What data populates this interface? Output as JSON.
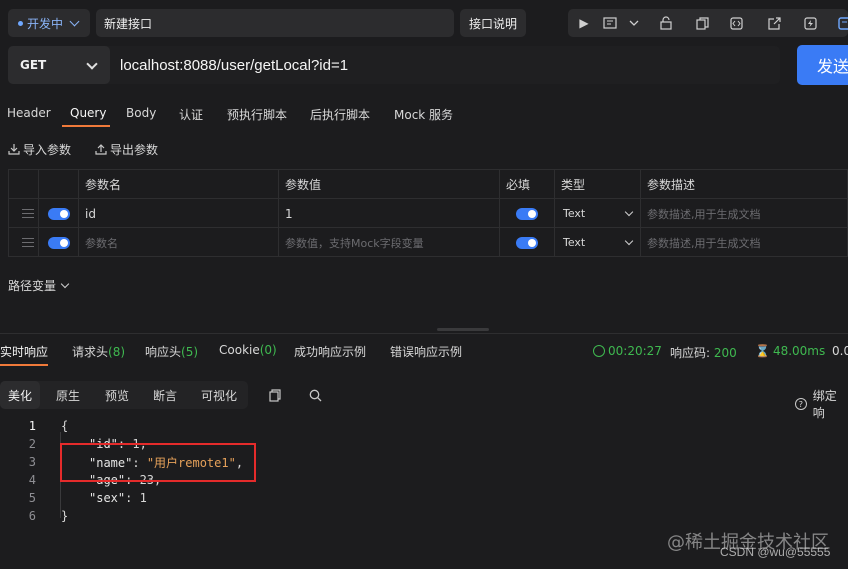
{
  "colors": {
    "accent": "#3a7bf5",
    "tab_underline": "#f07a3a",
    "success": "#3fb950",
    "env_dot": "#6fa8ff",
    "highlight": "#e52b2b"
  },
  "topbar": {
    "env_label": "开发中",
    "api_name": "新建接口",
    "doc_button": "接口说明",
    "tools": [
      "play-icon",
      "console-icon",
      "chevron-down-icon",
      "lock-icon",
      "copy-icon",
      "code-icon",
      "share-icon",
      "bolt-icon",
      "save-icon"
    ]
  },
  "request": {
    "method": "GET",
    "url": "localhost:8088/user/getLocal?id=1",
    "send_label": "发送"
  },
  "req_tabs": [
    "Header",
    "Query",
    "Body",
    "认证",
    "预执行脚本",
    "后执行脚本",
    "Mock 服务"
  ],
  "param_actions": {
    "import": "导入参数",
    "export": "导出参数"
  },
  "params_table": {
    "headers": [
      "参数名",
      "参数值",
      "必填",
      "类型",
      "参数描述"
    ],
    "rows": [
      {
        "name": "id",
        "value": "1",
        "type": "Text",
        "desc_placeholder": "参数描述,用于生成文档"
      }
    ],
    "empty_row": {
      "name_placeholder": "参数名",
      "value_placeholder": "参数值，支持Mock字段变量",
      "type": "Text",
      "desc_placeholder": "参数描述,用于生成文档"
    }
  },
  "path_vars_label": "路径变量",
  "resp_tabs": {
    "realtime": "实时响应",
    "req_headers": "请求头",
    "req_headers_count": "(8)",
    "resp_headers": "响应头",
    "resp_headers_count": "(5)",
    "cookie": "Cookie",
    "cookie_count": "(0)",
    "success_example": "成功响应示例",
    "error_example": "错误响应示例"
  },
  "meta": {
    "time": "00:20:27",
    "status_label": "响应码:",
    "status": "200",
    "duration": "48.00ms",
    "size": "0.0"
  },
  "view_modes": [
    "美化",
    "原生",
    "预览",
    "断言",
    "可视化"
  ],
  "bind_label": "绑定响",
  "code_lines": [
    {
      "num": "1",
      "text": "{"
    },
    {
      "num": "2",
      "key": "\"id\"",
      "sep": ": ",
      "val": "1",
      "tail": ","
    },
    {
      "num": "3",
      "key": "\"name\"",
      "sep": ": ",
      "str": "\"用户remote1\"",
      "tail": ","
    },
    {
      "num": "4",
      "key": "\"age\"",
      "sep": ": ",
      "val": "23",
      "tail": ","
    },
    {
      "num": "5",
      "key": "\"sex\"",
      "sep": ": ",
      "val": "1",
      "tail": ""
    },
    {
      "num": "6",
      "text": "}"
    }
  ],
  "watermark": {
    "site": "@稀土掘金技术社区",
    "author": "CSDN @wu@55555"
  }
}
